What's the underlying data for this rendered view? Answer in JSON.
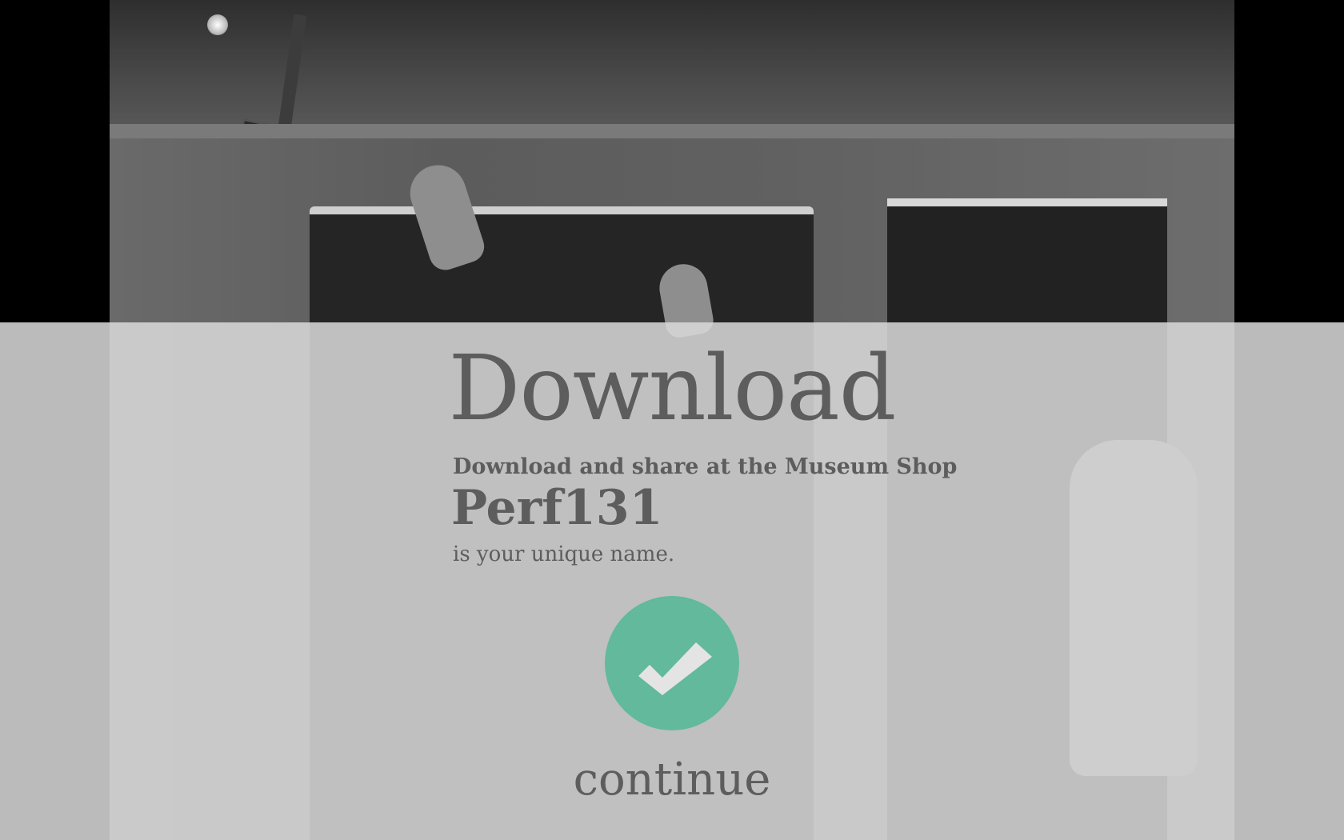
{
  "screen": {
    "title": "Download",
    "subtitle": "Download and share at the Museum Shop",
    "unique_name": "Perf131",
    "unique_name_caption": "is your unique name.",
    "continue_label": "continue"
  },
  "icons": {
    "confirm": "checkmark-icon"
  },
  "colors": {
    "accent": "#62b99b",
    "text": "#5d5d5d",
    "overlay": "#dadada"
  }
}
